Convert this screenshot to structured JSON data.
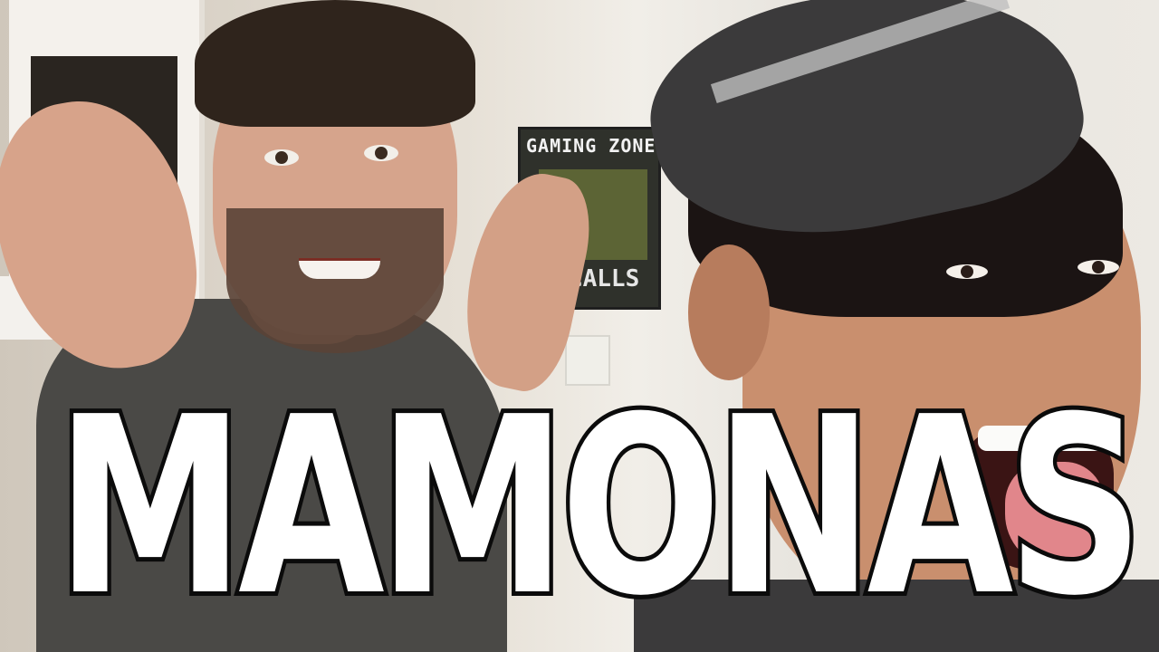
{
  "thumbnail": {
    "title_text": "MAMONAS",
    "poster": {
      "top_text": "GAMING ZONE",
      "bottom_text": "TY CALLS"
    }
  }
}
